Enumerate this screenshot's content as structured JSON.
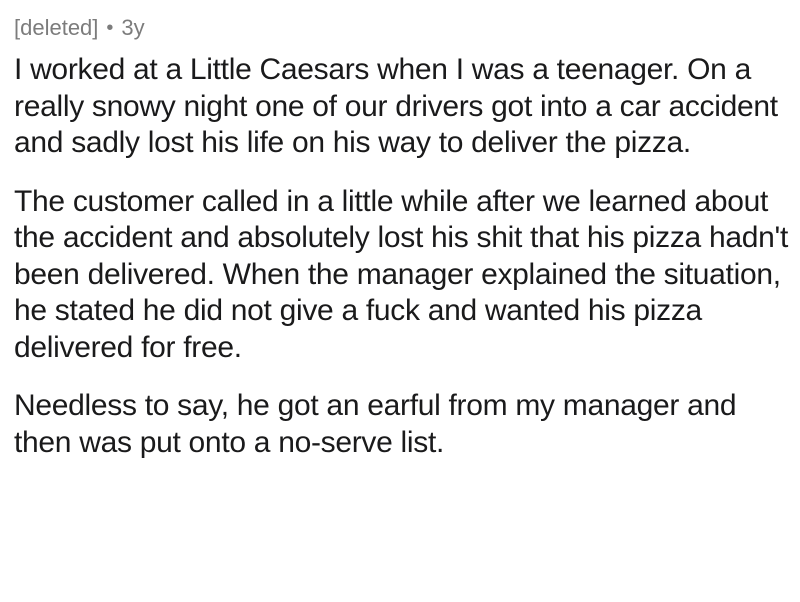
{
  "comment": {
    "author": "[deleted]",
    "separator": "•",
    "age": "3y",
    "paragraphs": [
      "I worked at a Little Caesars when I was a teenager. On a really snowy night one of our drivers got into a car accident and sadly lost his life on his way to deliver the pizza.",
      "The customer called in a little while after we learned about the accident and absolutely lost his shit that his pizza hadn't been delivered. When the manager explained the situation, he stated he did not give a fuck and wanted his pizza delivered for free.",
      "Needless to say, he got an earful from my manager and then was put onto a no-serve list."
    ]
  }
}
